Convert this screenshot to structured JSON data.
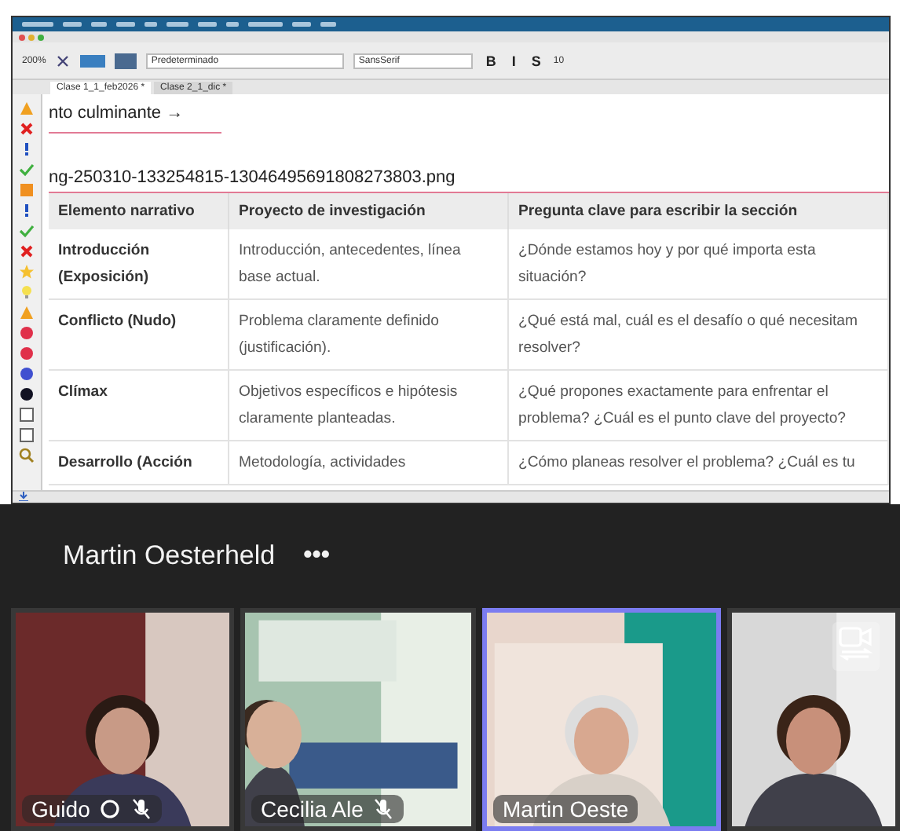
{
  "app": {
    "zoom": "200%",
    "paragraph_style": "Predeterminado",
    "font": "SansSerif",
    "font_size": "10",
    "format_buttons": [
      "B",
      "I",
      "S"
    ],
    "tabs": [
      {
        "label": "Clase 1_1_feb2026 *",
        "selected": true
      },
      {
        "label": "Clase 2_1_dic *",
        "selected": false
      }
    ]
  },
  "document": {
    "heading_fragment": "nto culminante →",
    "image_filename": "ng-250310-133254815-13046495691808273803.png",
    "table": {
      "columns": [
        "Elemento narrativo",
        "Proyecto de investigación",
        "Pregunta clave para escribir la sección"
      ],
      "rows": [
        {
          "cells": [
            [
              "Introducción",
              "(Exposición)"
            ],
            [
              "Introducción, antecedentes, línea",
              "base actual."
            ],
            [
              "¿Dónde estamos hoy y por qué importa esta",
              "situación?"
            ]
          ]
        },
        {
          "cells": [
            [
              "Conflicto (Nudo)"
            ],
            [
              "Problema claramente definido",
              "(justificación)."
            ],
            [
              "¿Qué está mal, cuál es el desafío o qué necesitam",
              "resolver?"
            ]
          ]
        },
        {
          "cells": [
            [
              "Clímax"
            ],
            [
              "Objetivos específicos e hipótesis",
              "claramente planteadas."
            ],
            [
              "¿Qué propones exactamente para enfrentar el",
              "problema? ¿Cuál es el punto clave del proyecto?"
            ]
          ]
        },
        {
          "cells": [
            [
              "Desarrollo (Acción"
            ],
            [
              "Metodología, actividades"
            ],
            [
              "¿Cómo planeas resolver el problema? ¿Cuál es tu"
            ]
          ]
        }
      ]
    }
  },
  "meeting": {
    "speaker": "Martin Oesterheld",
    "more": "•••",
    "participants": [
      {
        "name": "Guido",
        "muted": true,
        "status_icon": true,
        "selected": false,
        "switch_camera": false
      },
      {
        "name": "Cecilia Ale",
        "muted": true,
        "status_icon": false,
        "selected": false,
        "switch_camera": false
      },
      {
        "name": "Martin Oeste",
        "muted": false,
        "status_icon": false,
        "selected": true,
        "switch_camera": false
      },
      {
        "muted": false,
        "status_icon": false,
        "selected": false,
        "switch_camera": true
      }
    ]
  }
}
